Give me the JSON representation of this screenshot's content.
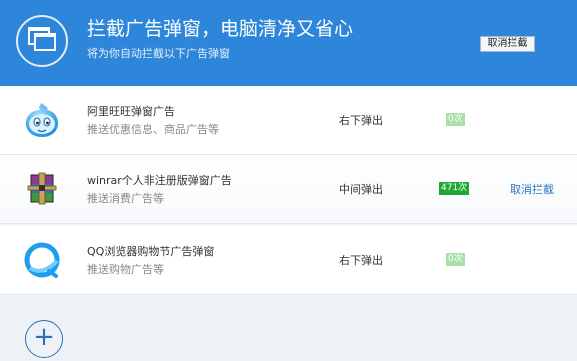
{
  "header": {
    "title": "拦截广告弹窗，电脑清净又省心",
    "subtitle": "将为你自动拦截以下广告弹窗",
    "cancel_all_label": "取消拦截",
    "color": "#2d86d9",
    "logo_icon": "windows-stack-icon"
  },
  "items": [
    {
      "name": "阿里旺旺弹窗广告",
      "desc": "推送优惠信息、商品广告等",
      "position": "右下弹出",
      "count": "0次",
      "action": "",
      "icon": "aliwangwang-icon"
    },
    {
      "name": "winrar个人非注册版弹窗广告",
      "desc": "推送消费广告等",
      "position": "中间弹出",
      "count": "471次",
      "action": "取消拦截",
      "icon": "winrar-icon"
    },
    {
      "name": "QQ浏览器购物节广告弹窗",
      "desc": "推送购物广告等",
      "position": "右下弹出",
      "count": "0次",
      "action": "",
      "icon": "qq-browser-icon"
    }
  ],
  "footer": {
    "add_label": "+",
    "add_icon": "plus-icon"
  }
}
